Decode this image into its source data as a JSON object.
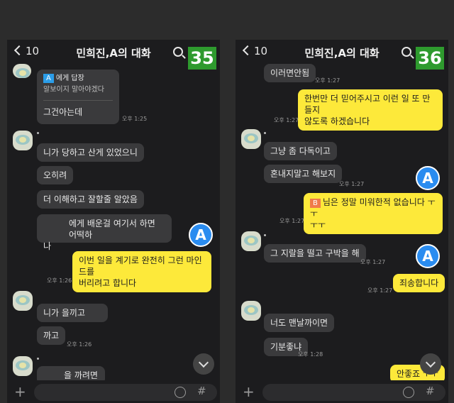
{
  "left": {
    "back_count": "10",
    "title": "민희진,A의 대화",
    "number": "35",
    "reply_to_tag": "A",
    "reply_to_text": "에게 답장",
    "reply_quote": "알보이지 말아야겠다",
    "reply_body": "그건아는데",
    "time1": "오후 1:25",
    "msgs": [
      "니가 당하고 산게 있었으니",
      "오히려",
      "더 이해하고 잘할줄 알았음",
      "에게 배운걸 여기서 하면 어떡하",
      "나"
    ],
    "my_msg": "이번 일을 계기로 완전히 그런 마인드를\n버리려고 합니다",
    "time2": "오후 1:26",
    "msgs2": [
      "니가          을끼고",
      "까고"
    ],
    "time3": "오후 1:26",
    "last_msg": "을 까려면",
    "badge": "A"
  },
  "right": {
    "back_count": "10",
    "title": "민희진,A의 대화",
    "number": "36",
    "m0": "이러면안됨",
    "t0": "오후 1:27",
    "my1": "한번만 더 믿어주시고 이런 일 또 만들지\n않도록 하겠습니다",
    "t1": "오후 1:27",
    "m2": "그냥 좀 다독이고",
    "m3": "혼내지말고 해보지",
    "t3": "오후 1:27",
    "tag_b": "B",
    "my2": "님은 정말 미워한적 없습니다 ㅜㅜ\nㅜㅜ",
    "t4": "오후 1:27",
    "m4": "그 지랄을 떨고 구박을 해",
    "t5": "오후 1:27",
    "my3": "죄송합니다",
    "t6": "오후 1:27",
    "m5": "너도 맨날까이면",
    "m6": "기분좋냐",
    "t7": "오후 1:28",
    "my4": "안좋죠 ㅜㅜ",
    "badge": "A"
  },
  "footer": {
    "hash": "#",
    "plus": "+"
  }
}
